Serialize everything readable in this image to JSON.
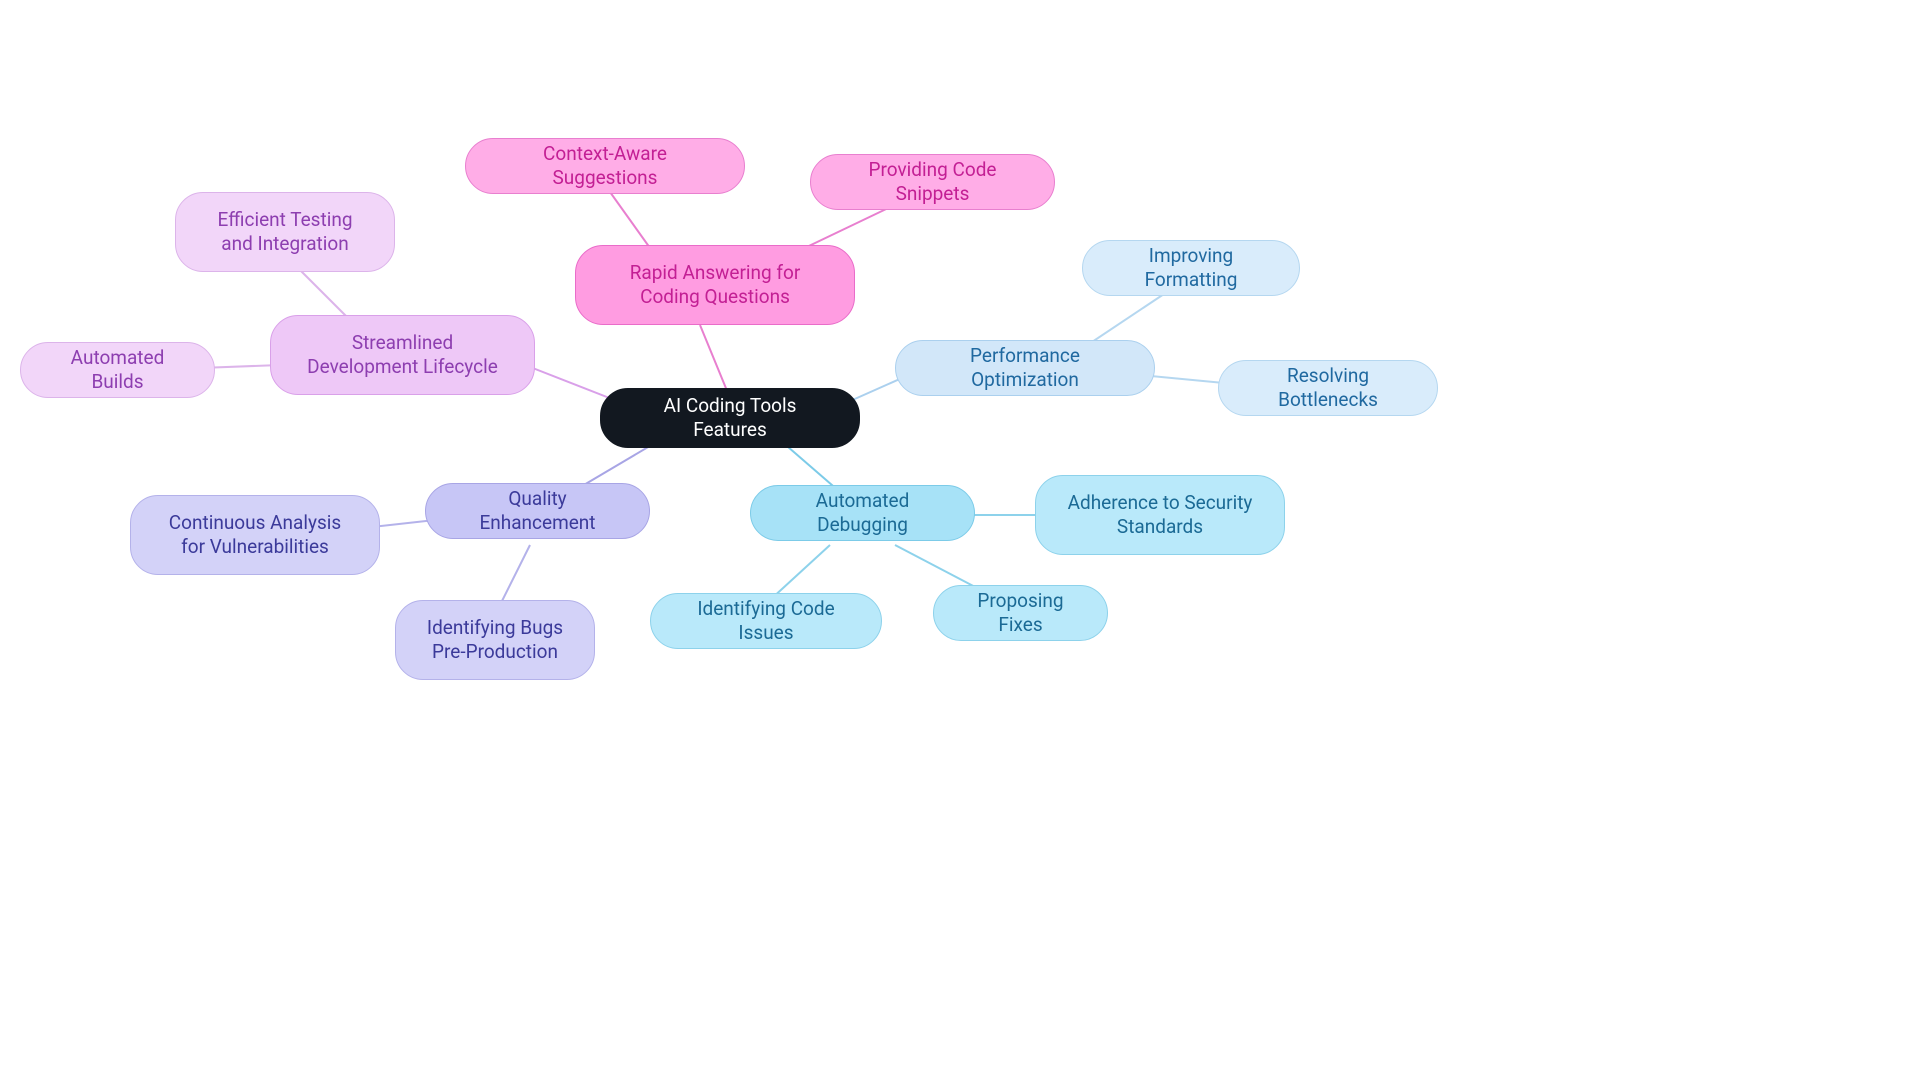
{
  "center": {
    "label": "AI Coding Tools Features"
  },
  "branches": {
    "pink": {
      "main": "Rapid Answering for Coding Questions",
      "leaves": [
        "Context-Aware Suggestions",
        "Providing Code Snippets"
      ]
    },
    "mag": {
      "main": "Streamlined Development Lifecycle",
      "leaves": [
        "Efficient Testing and Integration",
        "Automated Builds"
      ]
    },
    "lav": {
      "main": "Quality Enhancement",
      "leaves": [
        "Continuous Analysis for Vulnerabilities",
        "Identifying Bugs Pre-Production"
      ]
    },
    "cyan": {
      "main": "Automated Debugging",
      "leaves": [
        "Adherence to Security Standards",
        "Identifying Code Issues",
        "Proposing Fixes"
      ]
    },
    "blue": {
      "main": "Performance Optimization",
      "leaves": [
        "Improving Formatting",
        "Resolving Bottlenecks"
      ]
    }
  },
  "chart_data": {
    "type": "mindmap",
    "root": "AI Coding Tools Features",
    "children": [
      {
        "label": "Rapid Answering for Coding Questions",
        "color": "pink",
        "children": [
          {
            "label": "Context-Aware Suggestions"
          },
          {
            "label": "Providing Code Snippets"
          }
        ]
      },
      {
        "label": "Streamlined Development Lifecycle",
        "color": "magenta",
        "children": [
          {
            "label": "Efficient Testing and Integration"
          },
          {
            "label": "Automated Builds"
          }
        ]
      },
      {
        "label": "Quality Enhancement",
        "color": "lavender",
        "children": [
          {
            "label": "Continuous Analysis for Vulnerabilities"
          },
          {
            "label": "Identifying Bugs Pre-Production"
          }
        ]
      },
      {
        "label": "Automated Debugging",
        "color": "cyan",
        "children": [
          {
            "label": "Adherence to Security Standards"
          },
          {
            "label": "Identifying Code Issues"
          },
          {
            "label": "Proposing Fixes"
          }
        ]
      },
      {
        "label": "Performance Optimization",
        "color": "lightblue",
        "children": [
          {
            "label": "Improving Formatting"
          },
          {
            "label": "Resolving Bottlenecks"
          }
        ]
      }
    ]
  }
}
